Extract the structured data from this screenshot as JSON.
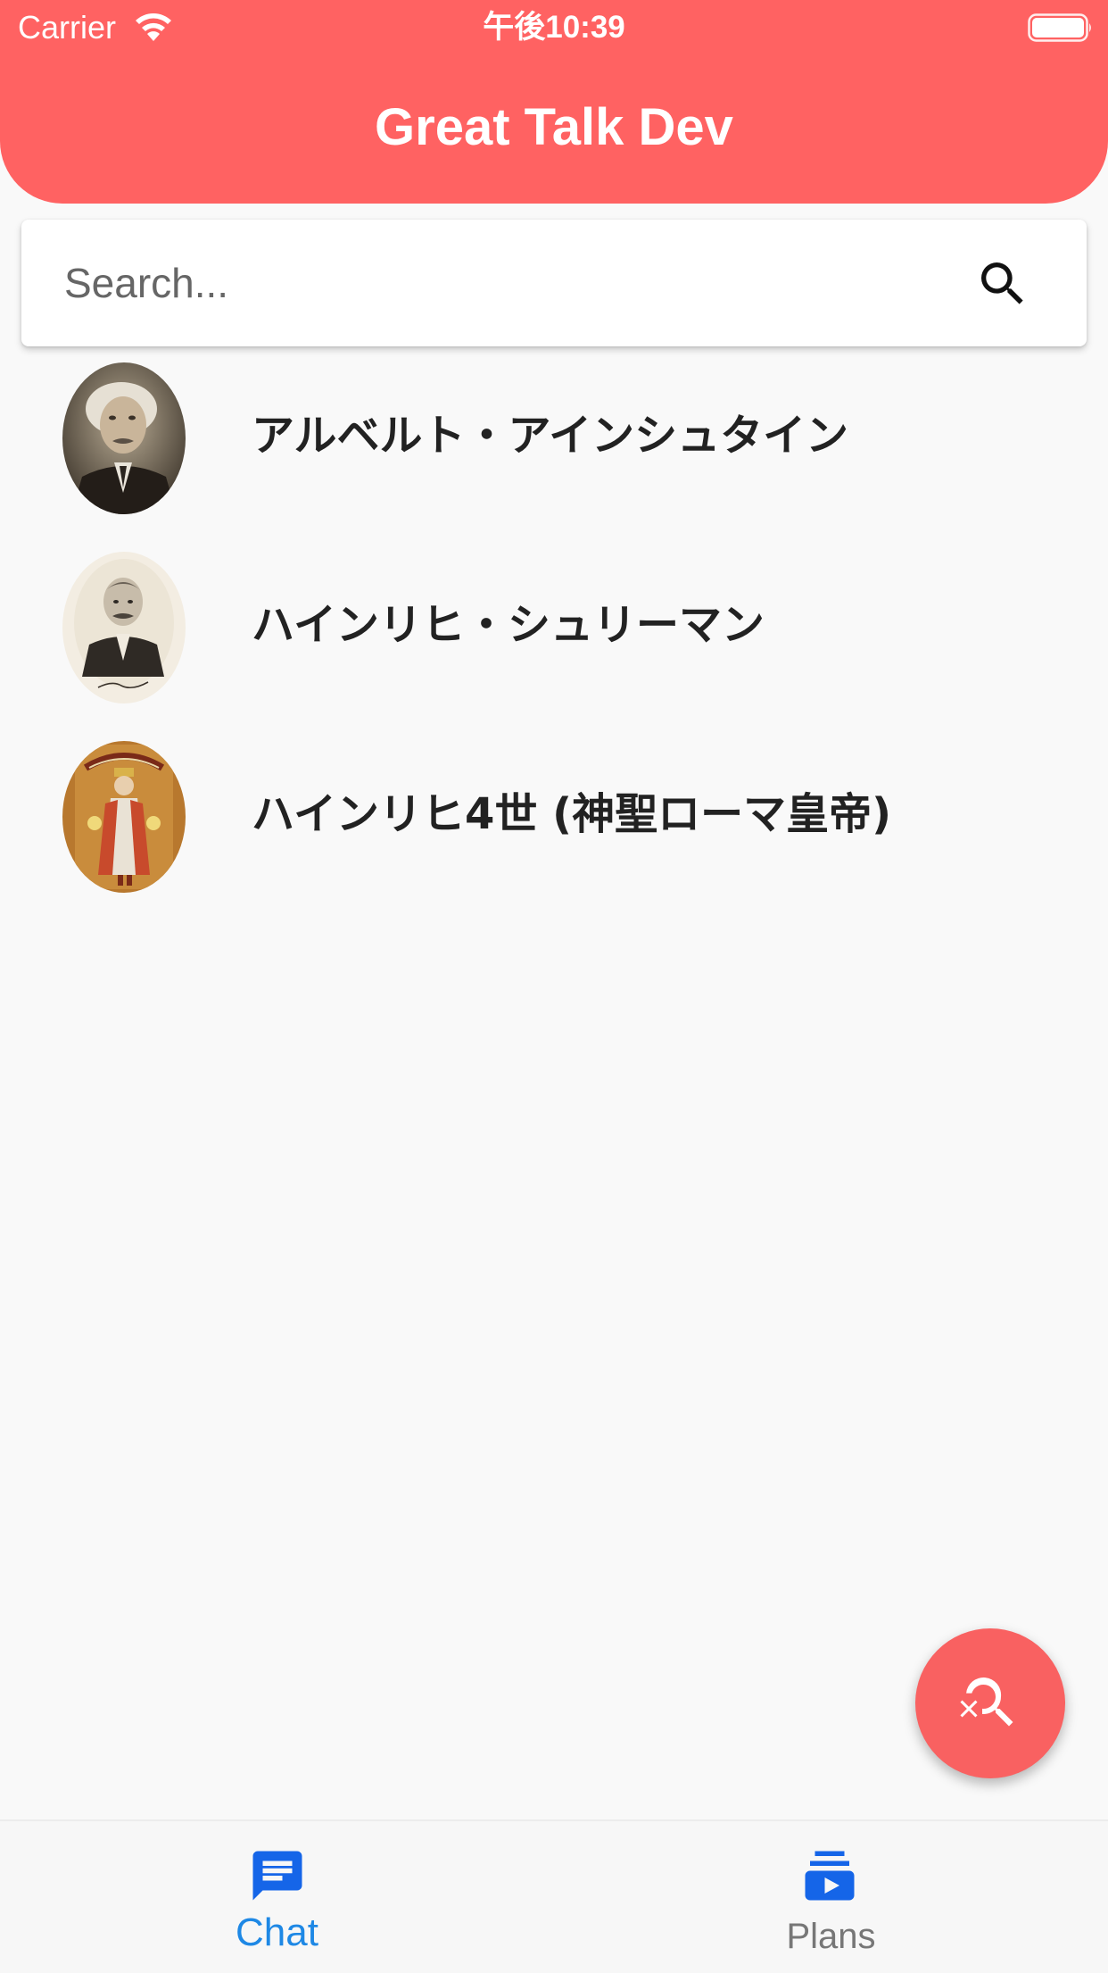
{
  "status_bar": {
    "carrier": "Carrier",
    "time": "午後10:39"
  },
  "app": {
    "title": "Great Talk Dev"
  },
  "search": {
    "placeholder": "Search...",
    "value": ""
  },
  "people": [
    {
      "name": "アルベルト・アインシュタイン",
      "avatar": "einstein-portrait"
    },
    {
      "name": "ハインリヒ・シュリーマン",
      "avatar": "schliemann-portrait"
    },
    {
      "name": "ハインリヒ4世 (神聖ローマ皇帝)",
      "avatar": "henry-iv-illumination"
    }
  ],
  "fab": {
    "icon": "search-off-icon"
  },
  "bottom_nav": {
    "items": [
      {
        "label": "Chat",
        "icon": "chat-icon",
        "active": true
      },
      {
        "label": "Plans",
        "icon": "subscriptions-icon",
        "active": false
      }
    ]
  },
  "colors": {
    "header": "#ff6262",
    "fab": "#f96161",
    "active_nav": "#1e88e5",
    "plans_icon": "#1565e8",
    "inactive_nav_label": "#777777",
    "background": "#f9f9f9"
  }
}
